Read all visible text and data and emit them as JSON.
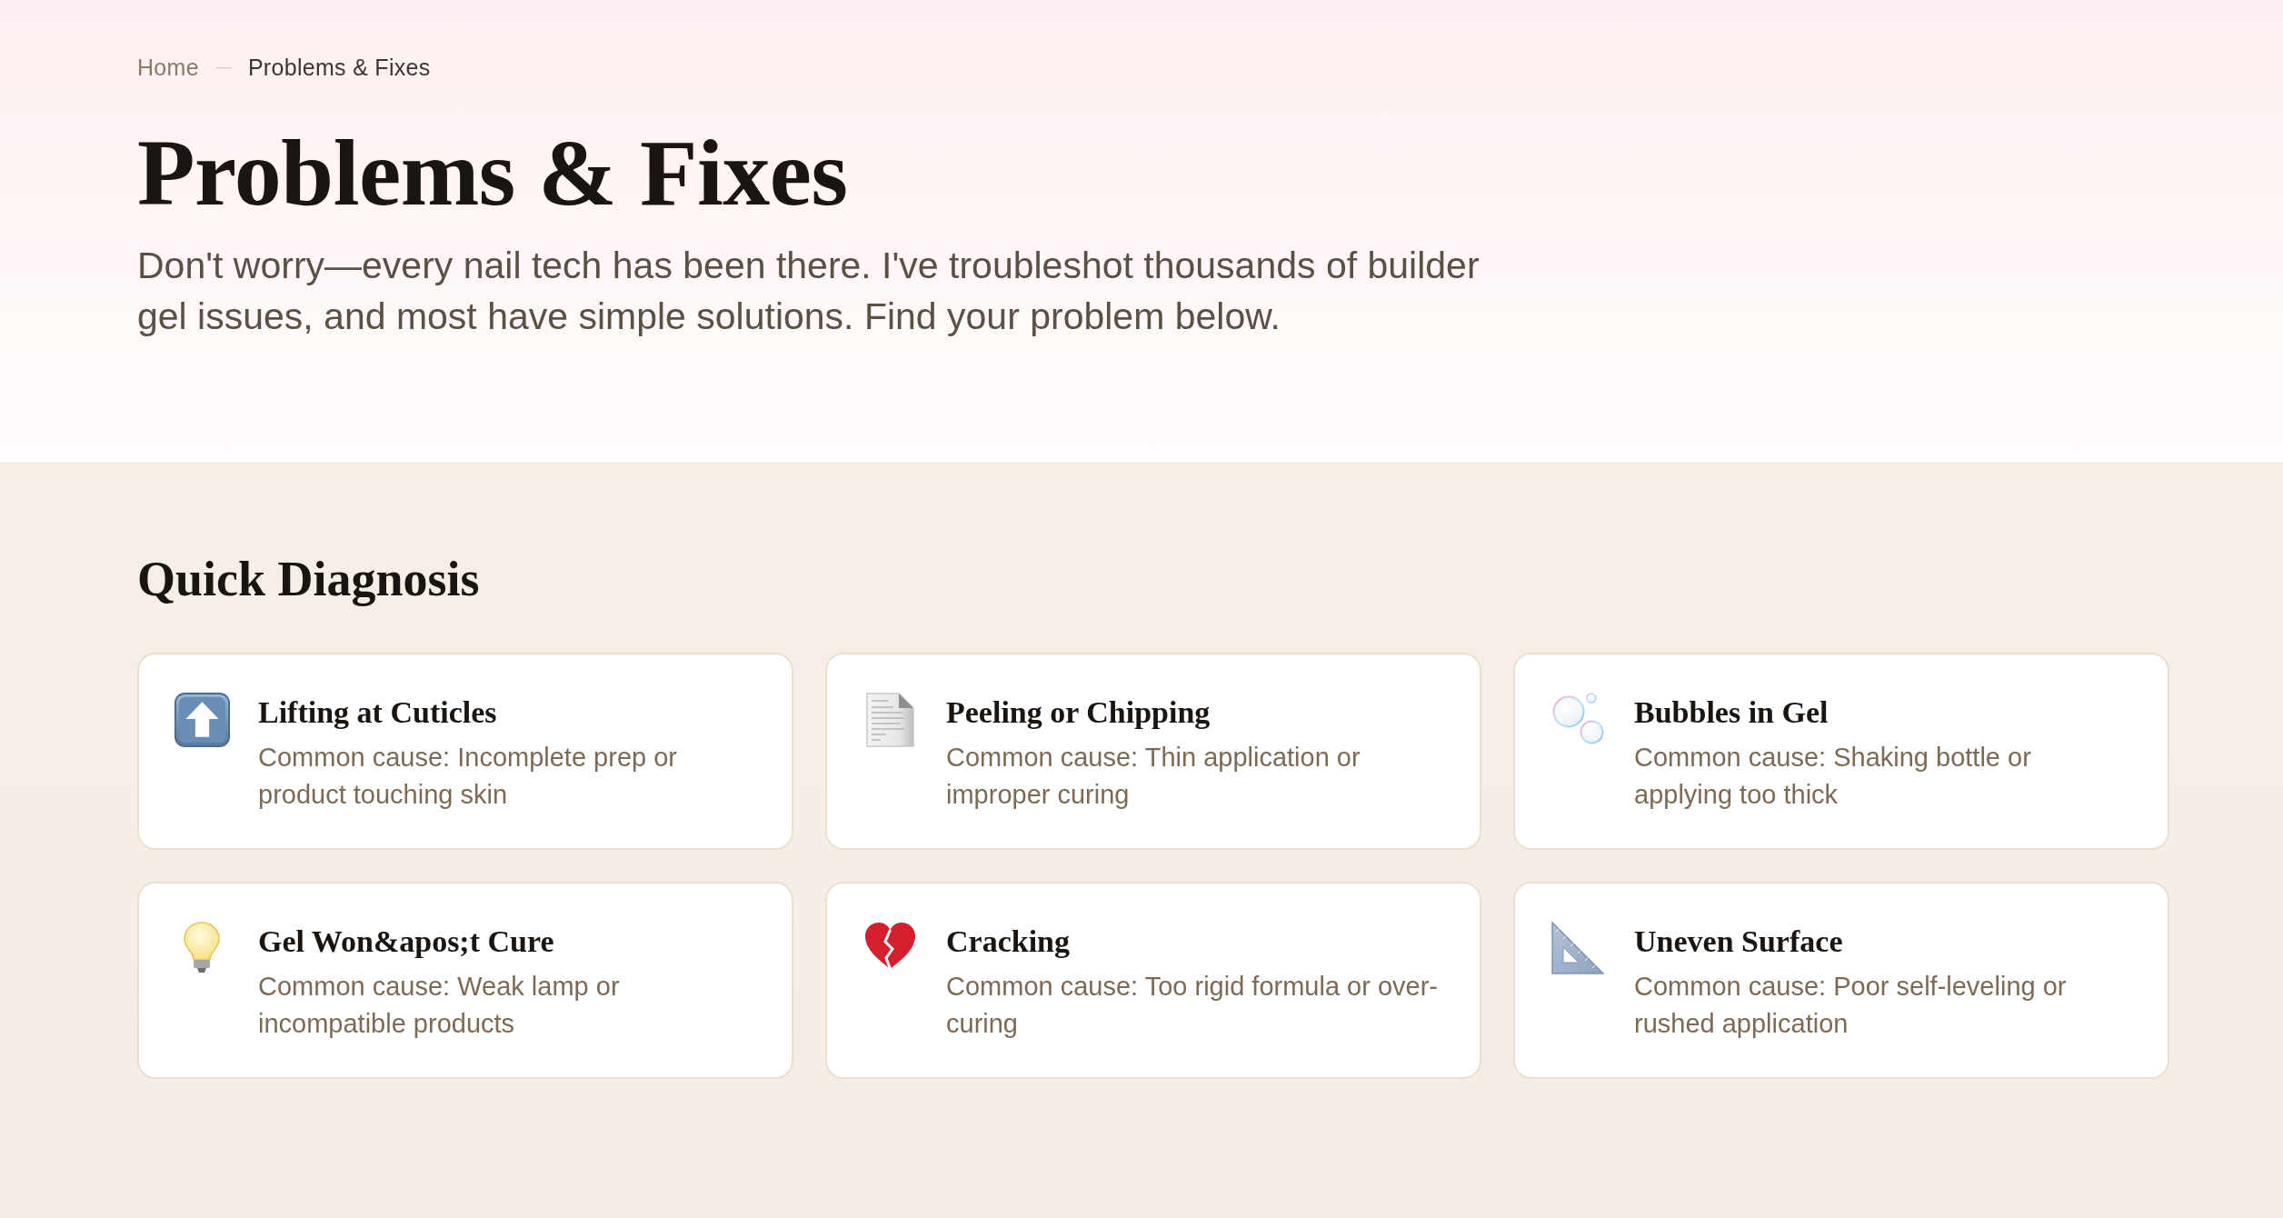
{
  "breadcrumb": {
    "items": [
      {
        "label": "Home",
        "kind": "link"
      },
      {
        "label": "Problems & Fixes",
        "kind": "current"
      }
    ],
    "separator": "—"
  },
  "page_title": "Problems & Fixes",
  "intro": "Don't worry—every nail tech has been there. I've troubleshot thousands of builder gel issues, and most have simple solutions. Find your problem below.",
  "quick_diagnosis": {
    "title": "Quick Diagnosis",
    "cards": [
      {
        "title": "Lifting at Cuticles",
        "description": "Common cause: Incomplete prep or product touching skin"
      },
      {
        "title": "Peeling or Chipping",
        "description": "Common cause: Thin application or improper curing"
      },
      {
        "title": "Bubbles in Gel",
        "description": "Common cause: Shaking bottle or applying too thick"
      },
      {
        "title": "Gel Won&apos;t Cure",
        "description": "Common cause: Weak lamp or incompatible products"
      },
      {
        "title": "Cracking",
        "description": "Common cause: Too rigid formula or over-curing"
      },
      {
        "title": "Uneven Surface",
        "description": "Common cause: Poor self-leveling or rushed application"
      }
    ]
  }
}
